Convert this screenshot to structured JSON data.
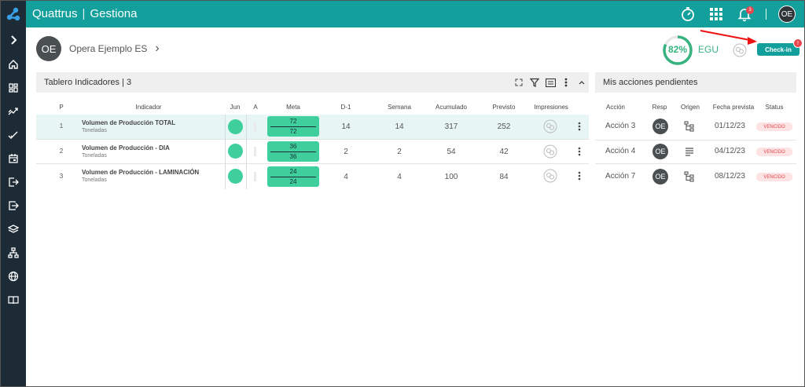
{
  "app": {
    "brand": "Quattrus",
    "separator": "|",
    "product": "Gestiona"
  },
  "topbar": {
    "icons": [
      "timer-icon",
      "apps-grid-icon",
      "bell-icon",
      "user-avatar"
    ],
    "notification_count": "3",
    "user_initials": "OE"
  },
  "sidebar": {
    "items": [
      "expand-chevron-icon",
      "home-icon",
      "dashboard-icon",
      "trend-icon",
      "check-icon",
      "calendar-icon",
      "logout-icon",
      "exit-icon",
      "layers-icon",
      "hierarchy-icon",
      "globe-icon",
      "book-icon"
    ]
  },
  "breadcrumb": {
    "avatar": "OE",
    "name": "Opera Ejemplo ES",
    "chevron": "›"
  },
  "score": {
    "percent": "82%",
    "value": 0.82,
    "label": "EGU"
  },
  "checkin": {
    "label": "Check-in",
    "badge": "!"
  },
  "indicators": {
    "title": "Tablero Indicadores | 3",
    "columns": {
      "p": "P",
      "indicator": "Indicador",
      "jun": "Jun",
      "a": "A",
      "meta": "Meta",
      "d1": "D-1",
      "semana": "Semana",
      "acumulado": "Acumulado",
      "previsto": "Previsto",
      "impresiones": "Impresiones"
    },
    "rows": [
      {
        "p": "1",
        "name": "Volumen de Producción TOTAL",
        "unit": "Toneladas",
        "meta_top": "72",
        "meta_bottom": "72",
        "d1": "14",
        "semana": "14",
        "acumulado": "317",
        "previsto": "252"
      },
      {
        "p": "2",
        "name": "Volumen de Producción - DIA",
        "unit": "Toneladas",
        "meta_top": "36",
        "meta_bottom": "36",
        "d1": "2",
        "semana": "2",
        "acumulado": "54",
        "previsto": "42"
      },
      {
        "p": "3",
        "name": "Volumen de Producción - LAMINACIÓN",
        "unit": "Toneladas",
        "meta_top": "24",
        "meta_bottom": "24",
        "d1": "4",
        "semana": "4",
        "acumulado": "100",
        "previsto": "84"
      }
    ]
  },
  "actions": {
    "title": "Mis acciones pendientes",
    "columns": {
      "accion": "Acción",
      "resp": "Resp",
      "origen": "Origen",
      "fecha": "Fecha prevista",
      "status": "Status"
    },
    "rows": [
      {
        "accion": "Acción 3",
        "resp": "OE",
        "origen": "hierarchy-icon",
        "fecha": "01/12/23",
        "status": "VENCIDO"
      },
      {
        "accion": "Acción 4",
        "resp": "OE",
        "origen": "list-icon",
        "fecha": "04/12/23",
        "status": "VENCIDO"
      },
      {
        "accion": "Acción 7",
        "resp": "OE",
        "origen": "hierarchy-icon",
        "fecha": "08/12/23",
        "status": "VENCIDO"
      }
    ]
  },
  "colors": {
    "teal": "#13a09d",
    "navy": "#1c2b36",
    "green": "#3ecf9c",
    "red": "#e5484d"
  }
}
